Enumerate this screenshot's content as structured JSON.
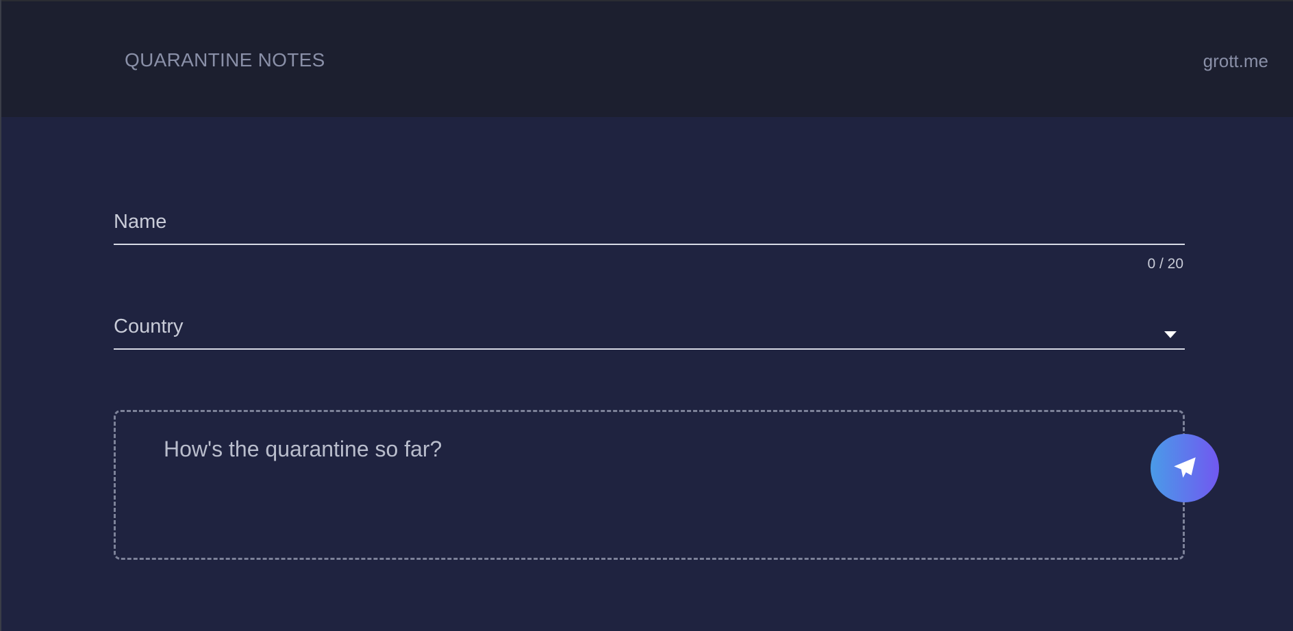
{
  "header": {
    "title": "QUARANTINE NOTES",
    "site_link": "grott.me"
  },
  "form": {
    "name_label": "Name",
    "name_counter": "0 / 20",
    "country_label": "Country",
    "note_placeholder": "How's the quarantine so far?"
  },
  "colors": {
    "accent_start": "#4a9be8",
    "accent_end": "#7158f0"
  }
}
